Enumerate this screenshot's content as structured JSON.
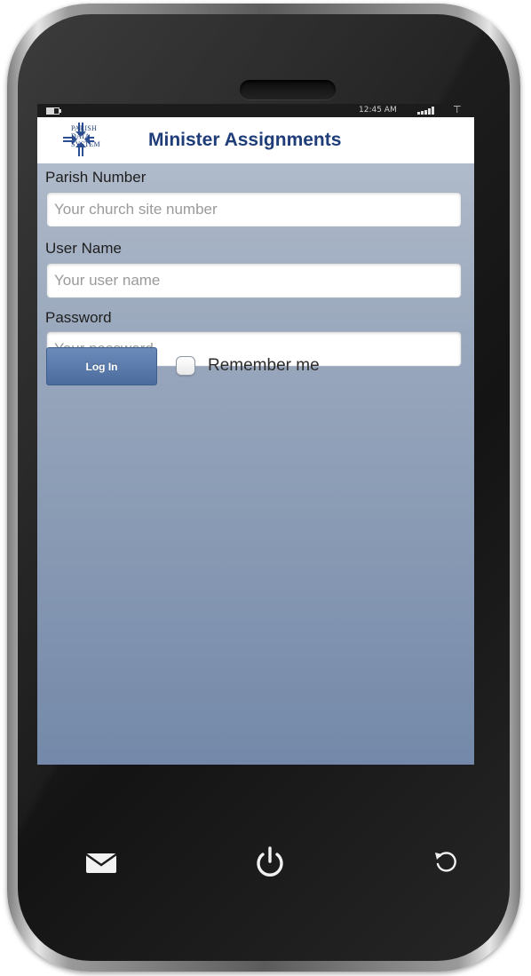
{
  "status_bar": {
    "time": "12:45 AM",
    "battery_icon": "battery-icon",
    "signal_icon": "signal-bars-icon",
    "antenna_icon": "antenna-icon"
  },
  "header": {
    "logo_lines": [
      "PARISH",
      "DATA",
      "SYSTEM"
    ],
    "title": "Minister Assignments",
    "brand_color": "#1f3d78"
  },
  "form": {
    "parish_number": {
      "label": "Parish Number",
      "placeholder": "Your church site number",
      "value": ""
    },
    "user_name": {
      "label": "User Name",
      "placeholder": "Your user name",
      "value": ""
    },
    "password": {
      "label": "Password",
      "placeholder": "Your password",
      "value": ""
    },
    "login_label": "Log In",
    "remember_label": "Remember me",
    "remember_checked": false
  },
  "device_buttons": {
    "mail_icon": "mail-icon",
    "power_icon": "power-icon",
    "back_icon": "back-icon"
  }
}
